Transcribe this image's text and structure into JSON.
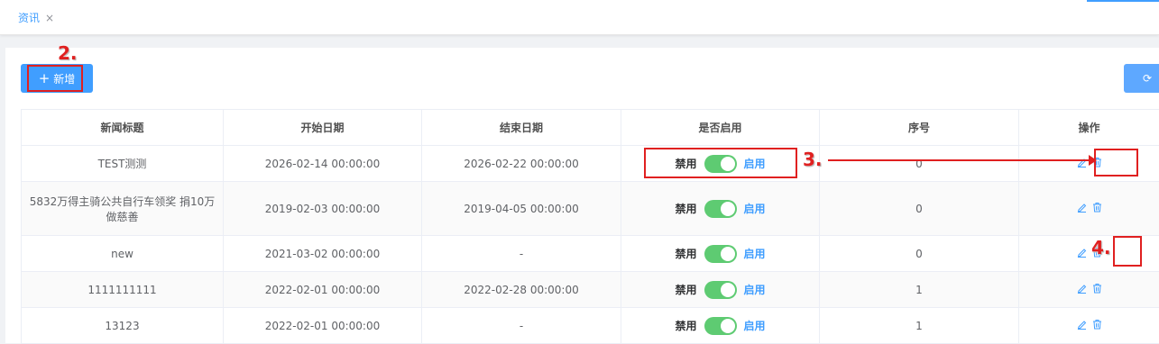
{
  "tabs": [
    {
      "label": "资讯",
      "close": "×"
    }
  ],
  "toolbar": {
    "add_label": "新增",
    "add_icon": "plus-icon",
    "refresh_icon": "refresh-icon"
  },
  "table": {
    "headers": [
      "新闻标题",
      "开始日期",
      "结束日期",
      "是否启用",
      "序号",
      "操作"
    ],
    "switch_off_label": "禁用",
    "switch_on_label": "启用",
    "rows": [
      {
        "title": "TEST测测",
        "start": "2026-02-14 00:00:00",
        "end": "2026-02-22 00:00:00",
        "enabled": true,
        "order": "0"
      },
      {
        "title": "5832万得主骑公共自行车领奖 捐10万做慈善",
        "start": "2019-02-03 00:00:00",
        "end": "2019-04-05 00:00:00",
        "enabled": true,
        "order": "0"
      },
      {
        "title": "new",
        "start": "2021-03-02 00:00:00",
        "end": "-",
        "enabled": true,
        "order": "0"
      },
      {
        "title": "1111111111",
        "start": "2022-02-01 00:00:00",
        "end": "2022-02-28 00:00:00",
        "enabled": true,
        "order": "1"
      },
      {
        "title": "13123",
        "start": "2022-02-01 00:00:00",
        "end": "-",
        "enabled": true,
        "order": "1"
      }
    ]
  },
  "annotations": [
    "2.",
    "3.",
    "4."
  ],
  "colors": {
    "accent": "#409eff",
    "switch_on": "#5ecb72",
    "annotation": "#e02020"
  }
}
